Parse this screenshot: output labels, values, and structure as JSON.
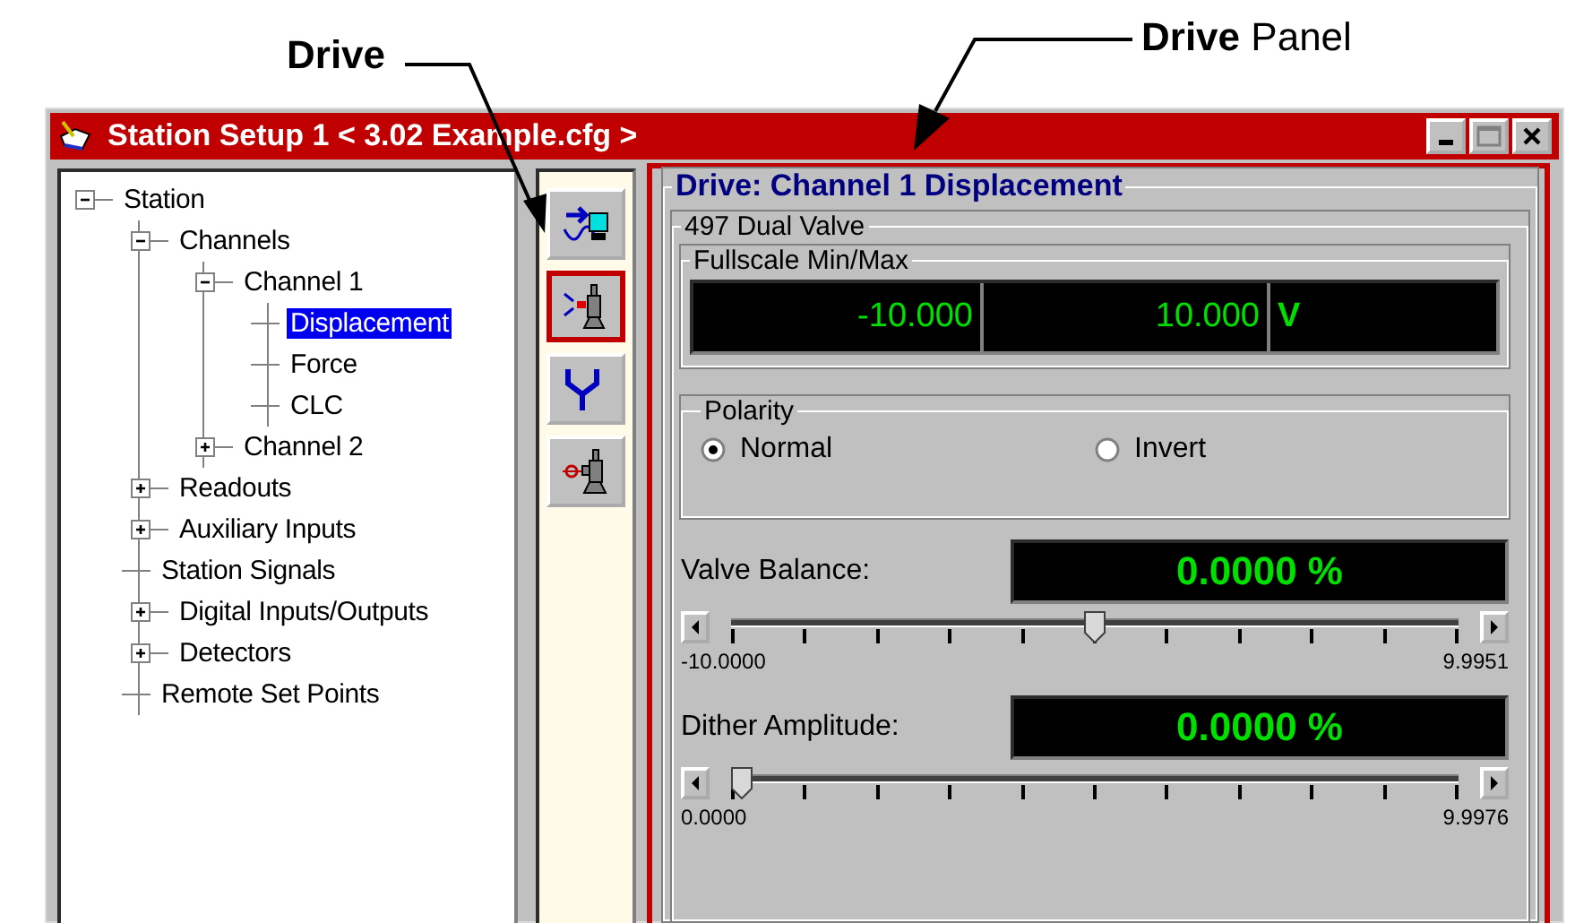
{
  "annotations": [
    {
      "kind": "bold",
      "text": "Drive"
    },
    {
      "kind": "mixed",
      "text": "**Drive** Panel"
    }
  ],
  "window": {
    "title": "Station Setup 1 < 3.02 Example.cfg >"
  },
  "tree": [
    {
      "label": "Station",
      "expanded": true,
      "selected": false,
      "children": [
        {
          "label": "Channels",
          "expanded": true,
          "selected": false,
          "children": [
            {
              "label": "Channel 1",
              "expanded": true,
              "selected": false,
              "children": [
                {
                  "label": "Displacement",
                  "selected": true
                },
                {
                  "label": "Force",
                  "selected": false
                },
                {
                  "label": "CLC",
                  "selected": false
                }
              ]
            },
            {
              "label": "Channel 2",
              "expanded": false,
              "selected": false
            }
          ]
        },
        {
          "label": "Readouts",
          "expanded": false,
          "selected": false
        },
        {
          "label": "Auxiliary Inputs",
          "expanded": false,
          "selected": false
        },
        {
          "label": "Station Signals",
          "selected": false
        },
        {
          "label": "Digital Inputs/Outputs",
          "expanded": false,
          "selected": false
        },
        {
          "label": "Detectors",
          "expanded": false,
          "selected": false
        },
        {
          "label": "Remote Set Points",
          "selected": false
        }
      ]
    }
  ],
  "toolbar": [
    {
      "kind": "signal",
      "selected": false
    },
    {
      "kind": "drive",
      "selected": true
    },
    {
      "kind": "fork",
      "selected": false
    },
    {
      "kind": "actuator",
      "selected": false
    }
  ],
  "panel": {
    "title": "Drive: Channel 1 Displacement",
    "group": "497 Dual Valve",
    "fullscale": {
      "label": "Fullscale Min/Max",
      "min": "-10.000",
      "max": "10.000",
      "unit": "V"
    },
    "polarity": {
      "label": "Polarity",
      "options": [
        {
          "label": "Normal",
          "selected": true
        },
        {
          "label": "Invert",
          "selected": false
        }
      ]
    },
    "sliders": [
      {
        "label": "Valve Balance:",
        "reading": "0.0000 %",
        "level": 0.5,
        "min": "-10.0000",
        "max": "9.9951"
      },
      {
        "label": "Dither Amplitude:",
        "reading": "0.0000 %",
        "level": 0,
        "min": "0.0000",
        "max": "9.9976"
      }
    ]
  }
}
